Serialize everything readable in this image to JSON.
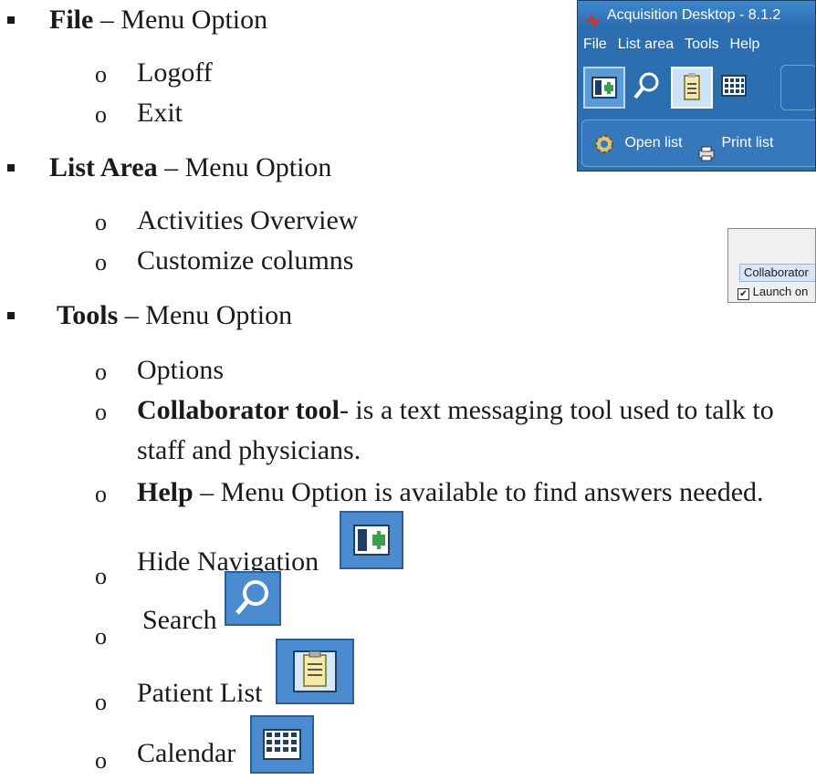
{
  "sections": {
    "file": {
      "title": "File",
      "suffix": " – Menu Option",
      "items": [
        "Logoff",
        "Exit"
      ]
    },
    "list_area": {
      "title": "List Area",
      "suffix": " – Menu Option",
      "items": [
        "Activities Overview",
        "Customize columns"
      ]
    },
    "tools": {
      "title": "Tools",
      "suffix": " – Menu Option",
      "options": "Options",
      "collab_title": "Collaborator tool",
      "collab_desc": "- is a text messaging tool used to talk to",
      "collab_desc2": "staff and physicians.",
      "help_title": "Help",
      "help_desc": " – Menu Option is available to find answers needed.",
      "hide_nav": "Hide Navigation",
      "search": "Search",
      "patient_list": "Patient List",
      "calendar": "Calendar"
    }
  },
  "app_window": {
    "title": "Acquisition Desktop - 8.1.2",
    "menu": [
      "File",
      "List area",
      "Tools",
      "Help"
    ],
    "open_list": "Open list",
    "print_list": "Print list"
  },
  "collaborator_panel": {
    "tab": "Collaborator",
    "checkbox_label": "Launch on"
  },
  "colors": {
    "window_blue": "#2b6fb0",
    "icon_bg": "#4a8ccf",
    "green_plus": "#3aa04a"
  }
}
